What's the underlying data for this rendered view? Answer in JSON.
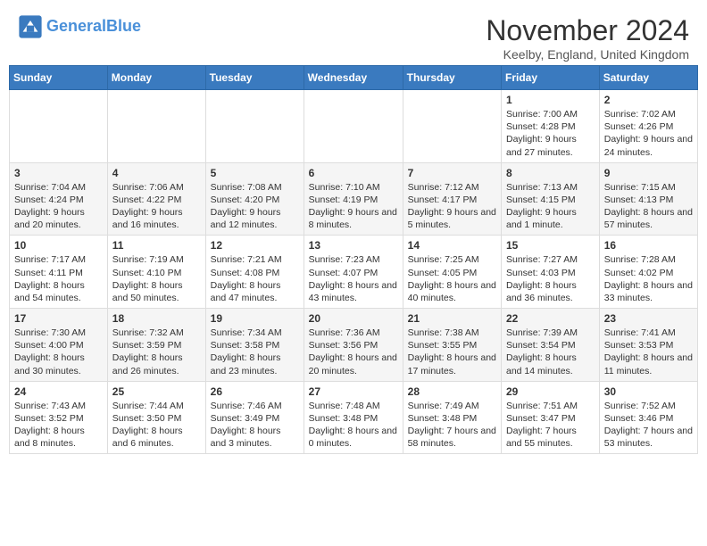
{
  "header": {
    "logo_line1": "General",
    "logo_line2": "Blue",
    "month_title": "November 2024",
    "location": "Keelby, England, United Kingdom"
  },
  "days_of_week": [
    "Sunday",
    "Monday",
    "Tuesday",
    "Wednesday",
    "Thursday",
    "Friday",
    "Saturday"
  ],
  "weeks": [
    [
      {
        "day": "",
        "info": ""
      },
      {
        "day": "",
        "info": ""
      },
      {
        "day": "",
        "info": ""
      },
      {
        "day": "",
        "info": ""
      },
      {
        "day": "",
        "info": ""
      },
      {
        "day": "1",
        "info": "Sunrise: 7:00 AM\nSunset: 4:28 PM\nDaylight: 9 hours and 27 minutes."
      },
      {
        "day": "2",
        "info": "Sunrise: 7:02 AM\nSunset: 4:26 PM\nDaylight: 9 hours and 24 minutes."
      }
    ],
    [
      {
        "day": "3",
        "info": "Sunrise: 7:04 AM\nSunset: 4:24 PM\nDaylight: 9 hours and 20 minutes."
      },
      {
        "day": "4",
        "info": "Sunrise: 7:06 AM\nSunset: 4:22 PM\nDaylight: 9 hours and 16 minutes."
      },
      {
        "day": "5",
        "info": "Sunrise: 7:08 AM\nSunset: 4:20 PM\nDaylight: 9 hours and 12 minutes."
      },
      {
        "day": "6",
        "info": "Sunrise: 7:10 AM\nSunset: 4:19 PM\nDaylight: 9 hours and 8 minutes."
      },
      {
        "day": "7",
        "info": "Sunrise: 7:12 AM\nSunset: 4:17 PM\nDaylight: 9 hours and 5 minutes."
      },
      {
        "day": "8",
        "info": "Sunrise: 7:13 AM\nSunset: 4:15 PM\nDaylight: 9 hours and 1 minute."
      },
      {
        "day": "9",
        "info": "Sunrise: 7:15 AM\nSunset: 4:13 PM\nDaylight: 8 hours and 57 minutes."
      }
    ],
    [
      {
        "day": "10",
        "info": "Sunrise: 7:17 AM\nSunset: 4:11 PM\nDaylight: 8 hours and 54 minutes."
      },
      {
        "day": "11",
        "info": "Sunrise: 7:19 AM\nSunset: 4:10 PM\nDaylight: 8 hours and 50 minutes."
      },
      {
        "day": "12",
        "info": "Sunrise: 7:21 AM\nSunset: 4:08 PM\nDaylight: 8 hours and 47 minutes."
      },
      {
        "day": "13",
        "info": "Sunrise: 7:23 AM\nSunset: 4:07 PM\nDaylight: 8 hours and 43 minutes."
      },
      {
        "day": "14",
        "info": "Sunrise: 7:25 AM\nSunset: 4:05 PM\nDaylight: 8 hours and 40 minutes."
      },
      {
        "day": "15",
        "info": "Sunrise: 7:27 AM\nSunset: 4:03 PM\nDaylight: 8 hours and 36 minutes."
      },
      {
        "day": "16",
        "info": "Sunrise: 7:28 AM\nSunset: 4:02 PM\nDaylight: 8 hours and 33 minutes."
      }
    ],
    [
      {
        "day": "17",
        "info": "Sunrise: 7:30 AM\nSunset: 4:00 PM\nDaylight: 8 hours and 30 minutes."
      },
      {
        "day": "18",
        "info": "Sunrise: 7:32 AM\nSunset: 3:59 PM\nDaylight: 8 hours and 26 minutes."
      },
      {
        "day": "19",
        "info": "Sunrise: 7:34 AM\nSunset: 3:58 PM\nDaylight: 8 hours and 23 minutes."
      },
      {
        "day": "20",
        "info": "Sunrise: 7:36 AM\nSunset: 3:56 PM\nDaylight: 8 hours and 20 minutes."
      },
      {
        "day": "21",
        "info": "Sunrise: 7:38 AM\nSunset: 3:55 PM\nDaylight: 8 hours and 17 minutes."
      },
      {
        "day": "22",
        "info": "Sunrise: 7:39 AM\nSunset: 3:54 PM\nDaylight: 8 hours and 14 minutes."
      },
      {
        "day": "23",
        "info": "Sunrise: 7:41 AM\nSunset: 3:53 PM\nDaylight: 8 hours and 11 minutes."
      }
    ],
    [
      {
        "day": "24",
        "info": "Sunrise: 7:43 AM\nSunset: 3:52 PM\nDaylight: 8 hours and 8 minutes."
      },
      {
        "day": "25",
        "info": "Sunrise: 7:44 AM\nSunset: 3:50 PM\nDaylight: 8 hours and 6 minutes."
      },
      {
        "day": "26",
        "info": "Sunrise: 7:46 AM\nSunset: 3:49 PM\nDaylight: 8 hours and 3 minutes."
      },
      {
        "day": "27",
        "info": "Sunrise: 7:48 AM\nSunset: 3:48 PM\nDaylight: 8 hours and 0 minutes."
      },
      {
        "day": "28",
        "info": "Sunrise: 7:49 AM\nSunset: 3:48 PM\nDaylight: 7 hours and 58 minutes."
      },
      {
        "day": "29",
        "info": "Sunrise: 7:51 AM\nSunset: 3:47 PM\nDaylight: 7 hours and 55 minutes."
      },
      {
        "day": "30",
        "info": "Sunrise: 7:52 AM\nSunset: 3:46 PM\nDaylight: 7 hours and 53 minutes."
      }
    ]
  ]
}
